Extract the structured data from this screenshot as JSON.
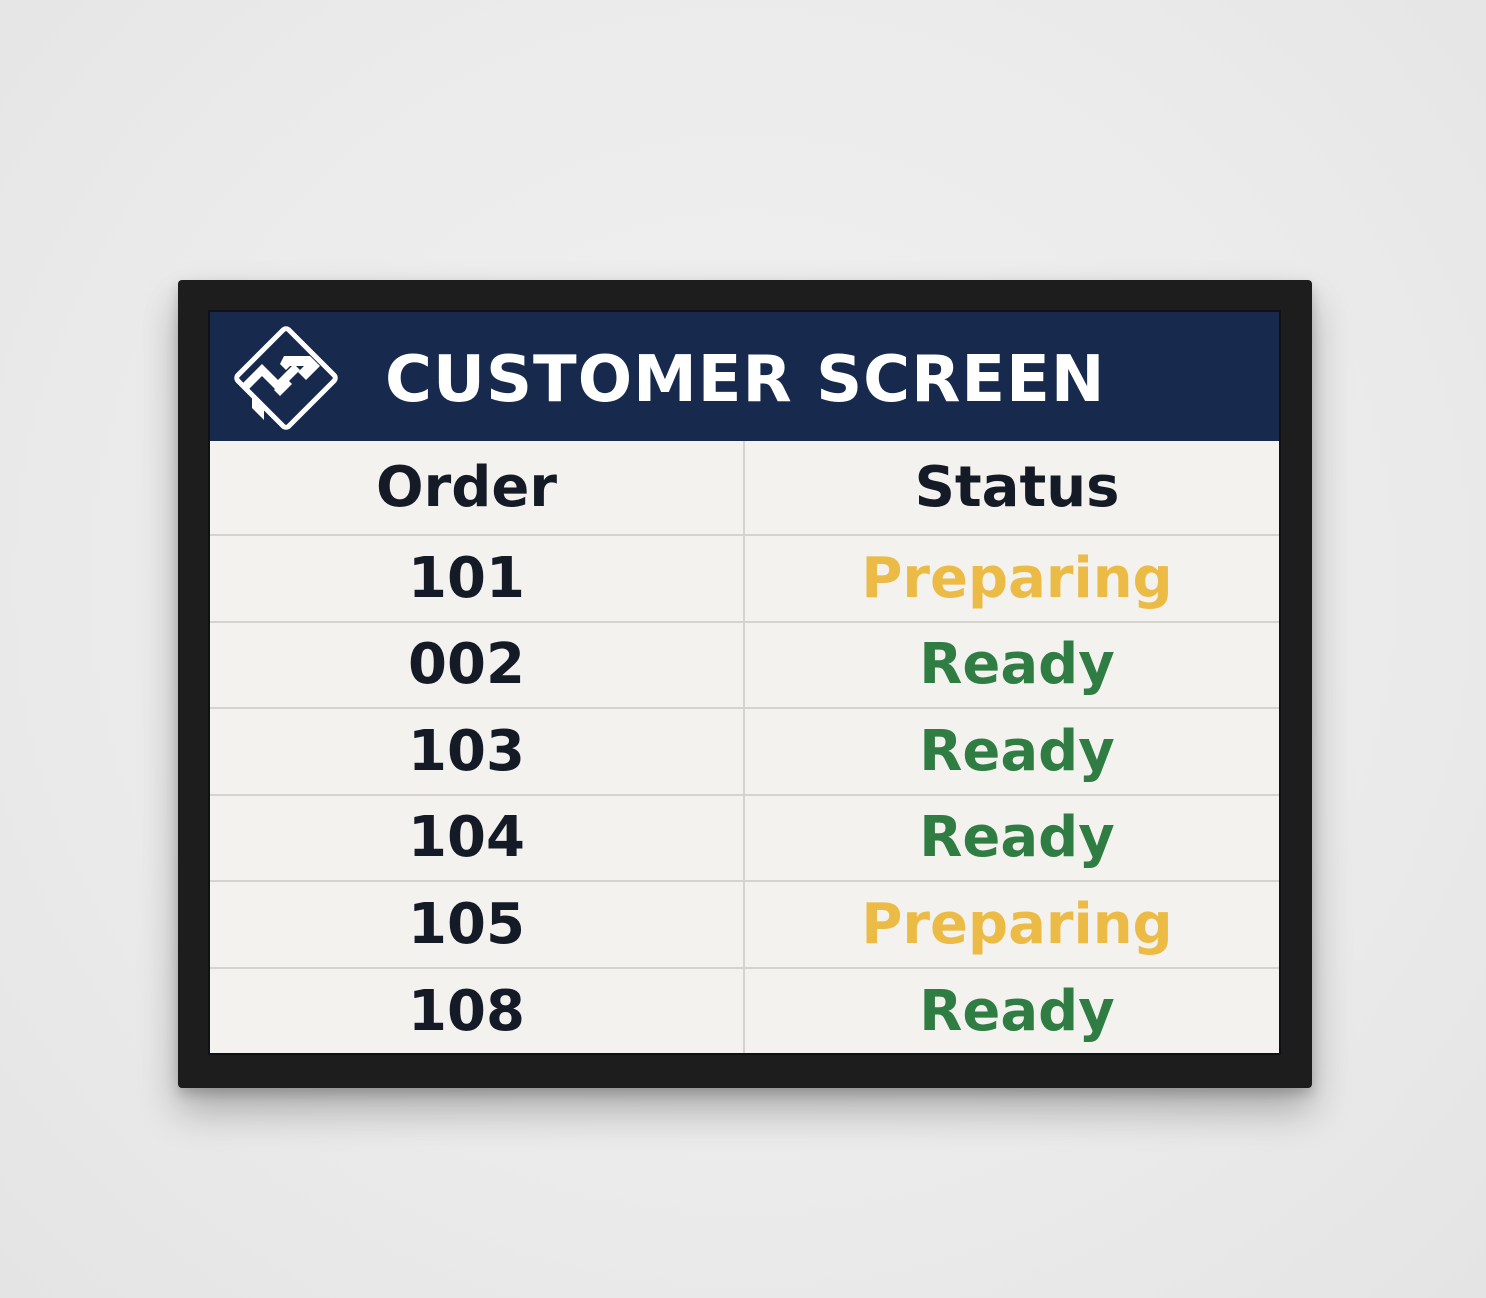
{
  "header": {
    "title": "CUSTOMER SCREEN",
    "logo_icon": "diamond-monogram-logo"
  },
  "table": {
    "columns": [
      "Order",
      "Status"
    ],
    "rows": [
      {
        "order": "101",
        "status": "Preparing",
        "status_color": "#ecbb45"
      },
      {
        "order": "002",
        "status": "Ready",
        "status_color": "#2f7d43"
      },
      {
        "order": "103",
        "status": "Ready",
        "status_color": "#2f7d43"
      },
      {
        "order": "104",
        "status": "Ready",
        "status_color": "#2f7d43"
      },
      {
        "order": "105",
        "status": "Preparing",
        "status_color": "#ecbb45"
      },
      {
        "order": "108",
        "status": "Ready",
        "status_color": "#2f7d43"
      }
    ]
  },
  "colors": {
    "header_bg": "#172a4d",
    "preparing": "#ecbb45",
    "ready": "#2f7d43",
    "text_dark": "#141a26"
  }
}
